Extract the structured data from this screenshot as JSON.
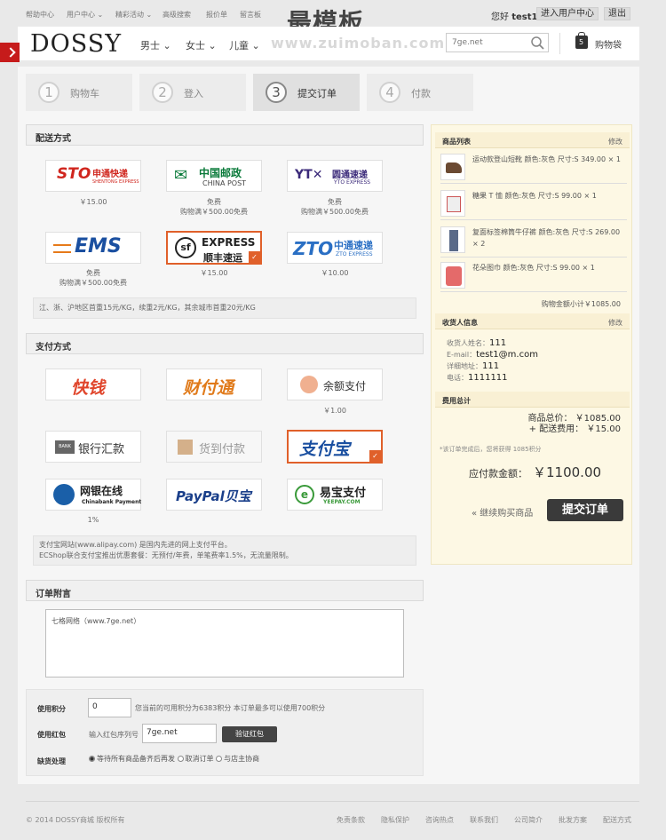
{
  "topbar": {
    "links": [
      "帮助中心",
      "用户中心",
      "精彩活动",
      "高级搜索",
      "报价单",
      "留言板"
    ],
    "greeting": "您好",
    "username": "test1",
    "user_center": "进入用户中心",
    "logout": "退出"
  },
  "watermark": {
    "title": "最模板",
    "url": "www.zuimoban.com"
  },
  "header": {
    "logo": "DOSSY",
    "nav": [
      "男士",
      "女士",
      "儿童"
    ],
    "search_value": "7ge.net",
    "cart_count": "5",
    "cart_label": "购物袋"
  },
  "steps": [
    {
      "num": "1",
      "label": "购物车"
    },
    {
      "num": "2",
      "label": "登入"
    },
    {
      "num": "3",
      "label": "提交订单"
    },
    {
      "num": "4",
      "label": "付款"
    }
  ],
  "shipping": {
    "title": "配送方式",
    "options": [
      {
        "name": "申通快递",
        "sub": "SHENTONG EXPRESS",
        "caption1": "￥15.00",
        "caption2": ""
      },
      {
        "name": "中国邮政",
        "sub": "CHINA POST",
        "caption1": "免费",
        "caption2": "购物满￥500.00免费"
      },
      {
        "name": "圆通速递",
        "sub": "YTO EXPRESS",
        "caption1": "免费",
        "caption2": "购物满￥500.00免费"
      },
      {
        "name": "EMS",
        "sub": "",
        "caption1": "免费",
        "caption2": "购物满￥500.00免费"
      },
      {
        "name": "顺丰速运",
        "sub": "EXPRESS",
        "caption1": "￥15.00",
        "caption2": ""
      },
      {
        "name": "中通速递",
        "sub": "ZTO EXPRESS",
        "caption1": "￥10.00",
        "caption2": ""
      }
    ],
    "note": "江、浙、沪地区首重15元/KG，续重2元/KG，其余城市首重20元/KG"
  },
  "payment": {
    "title": "支付方式",
    "options": [
      {
        "name": "快钱",
        "caption": ""
      },
      {
        "name": "财付通",
        "caption": ""
      },
      {
        "name": "余额支付",
        "caption": "￥1.00"
      },
      {
        "name": "银行汇款",
        "caption": ""
      },
      {
        "name": "货到付款",
        "caption": ""
      },
      {
        "name": "支付宝",
        "caption": ""
      },
      {
        "name": "网银在线",
        "caption": "1%",
        "sub": "Chinabank Payment"
      },
      {
        "name": "PayPal贝宝",
        "caption": ""
      },
      {
        "name": "易宝支付",
        "caption": "",
        "sub": "YEEPAY.COM"
      }
    ],
    "note_line1": "支付宝网站(www.alipay.com) 是国内先进的网上支付平台。",
    "note_line2": "ECShop联合支付宝推出优惠套餐：无预付/年费，单笔费率1.5%，无流量限制。"
  },
  "remark": {
    "title": "订单附言",
    "text": "七格网络（www.7ge.net）"
  },
  "form": {
    "points_label": "使用积分",
    "points_value": "0",
    "points_hint": "您当前的可用积分为6383积分  本订单最多可以使用700积分",
    "bonus_label": "使用红包",
    "bonus_hint": "输入红包序列号",
    "bonus_value": "7ge.net",
    "bonus_button": "验证红包",
    "stock_label": "缺货处理",
    "stock_options": [
      "等待所有商品备齐后再发",
      "取消订单",
      "与店主协商"
    ]
  },
  "sidebar": {
    "items_title": "商品列表",
    "edit": "修改",
    "items": [
      {
        "text": "运动款登山短靴 颜色:灰色 尺寸:S 349.00 × 1"
      },
      {
        "text": "糖果 T 恤 颜色:灰色 尺寸:S 99.00 × 1"
      },
      {
        "text": "复面标签棉筒牛仔裤 颜色:灰色 尺寸:S 269.00 × 2"
      },
      {
        "text": "花朵图巾 颜色:灰色 尺寸:S 99.00 × 1"
      }
    ],
    "subtotal": "购物金额小计￥1085.00",
    "consignee_title": "收货人信息",
    "consignee": [
      {
        "label": "收货人姓名：",
        "value": "111"
      },
      {
        "label": "E-mail：",
        "value": "test1@m.com"
      },
      {
        "label": "详细地址：",
        "value": "111"
      },
      {
        "label": "电话：",
        "value": "1111111"
      }
    ],
    "fee_title": "费用总计",
    "goods_total": "商品总价： ￥1085.00",
    "shipping_fee": "+ 配送费用： ￥15.00",
    "points_note": "*该订单完成后，您将获得 1085积分",
    "payable_label": "应付款金额：",
    "payable_value": "￥1100.00",
    "continue": "« 继续购买商品",
    "submit": "提交订单"
  },
  "footer": {
    "copyright": "© 2014 DOSSY商城 版权所有",
    "links": [
      "免责条款",
      "隐私保护",
      "咨询热点",
      "联系我们",
      "公司简介",
      "批发方案",
      "配送方式"
    ]
  }
}
